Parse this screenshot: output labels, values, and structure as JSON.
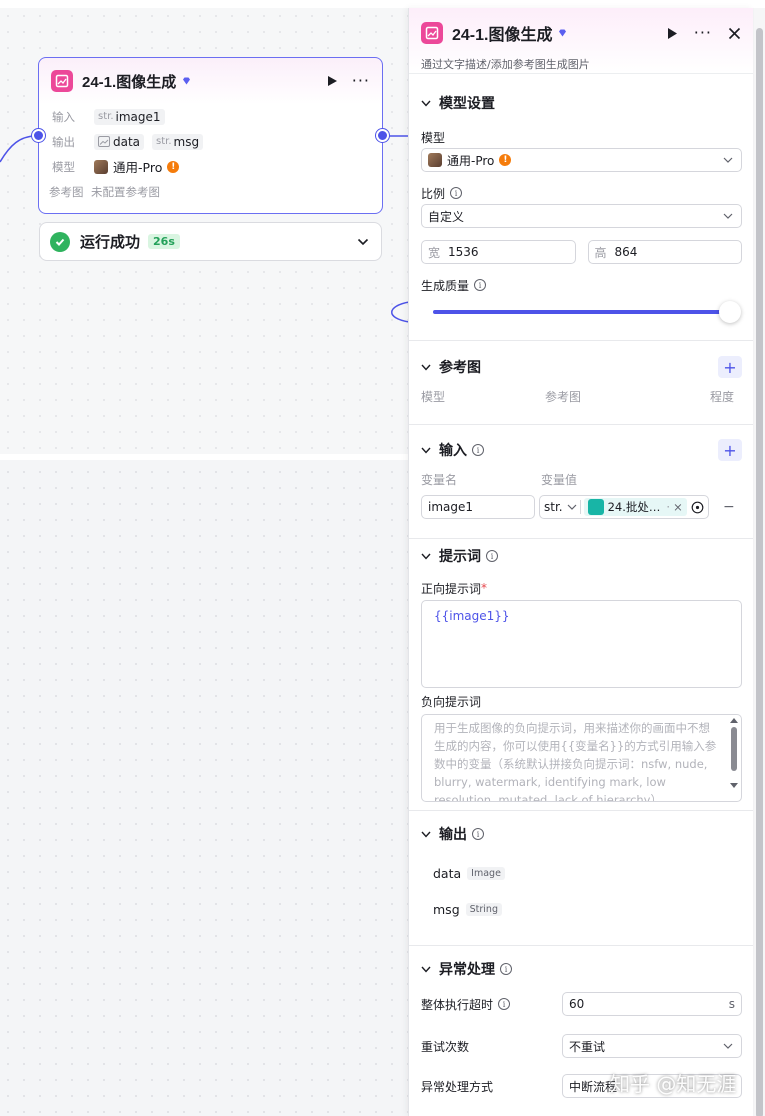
{
  "node": {
    "title": "24-1.图像生成",
    "input_label": "输入",
    "input_type": "str.",
    "input_name": "image1",
    "output_label": "输出",
    "output_data": "data",
    "output_msg_type": "str.",
    "output_msg": "msg",
    "model_label": "模型",
    "model_name": "通用-Pro",
    "ref_label": "参考图",
    "ref_value": "未配置参考图"
  },
  "status": {
    "text": "运行成功",
    "duration": "26s"
  },
  "panel": {
    "title": "24-1.图像生成",
    "description": "通过文字描述/添加参考图生成图片",
    "model_section": {
      "title": "模型设置",
      "model_label": "模型",
      "model_value": "通用-Pro",
      "ratio_label": "比例",
      "ratio_value": "自定义",
      "width_prefix": "宽",
      "width_value": "1536",
      "height_prefix": "高",
      "height_value": "864",
      "quality_label": "生成质量",
      "quality_level": 1.0
    },
    "ref_section": {
      "title": "参考图",
      "col_model": "模型",
      "col_ref": "参考图",
      "col_degree": "程度"
    },
    "input_section": {
      "title": "输入",
      "col_name": "变量名",
      "col_value": "变量值",
      "var_name": "image1",
      "var_type": "str.",
      "var_ref": "24.批处…",
      "var_ref_suffix": "·"
    },
    "prompt_section": {
      "title": "提示词",
      "positive_label": "正向提示词",
      "required_mark": "*",
      "positive_value": "{{image1}}",
      "negative_label": "负向提示词",
      "negative_placeholder": "用于生成图像的负向提示词，用来描述你的画面中不想生成的内容，你可以使用{{变量名}}的方式引用输入参数中的变量（系统默认拼接负向提示词：nsfw, nude, blurry, watermark, identifying mark, low resolution, mutated, lack of hierarchy）"
    },
    "output_section": {
      "title": "输出",
      "items": [
        {
          "name": "data",
          "type": "Image"
        },
        {
          "name": "msg",
          "type": "String"
        }
      ]
    },
    "exception_section": {
      "title": "异常处理",
      "timeout_label": "整体执行超时",
      "timeout_value": "60",
      "timeout_unit": "s",
      "retry_label": "重试次数",
      "retry_value": "不重试",
      "handling_label": "异常处理方式",
      "handling_value": "中断流程"
    }
  },
  "watermark": "知乎 @知无涯",
  "colors": {
    "accent": "#4d53e8",
    "node_icon": "#ec4899",
    "success": "#2fb35e",
    "warning": "#f57c0b"
  }
}
